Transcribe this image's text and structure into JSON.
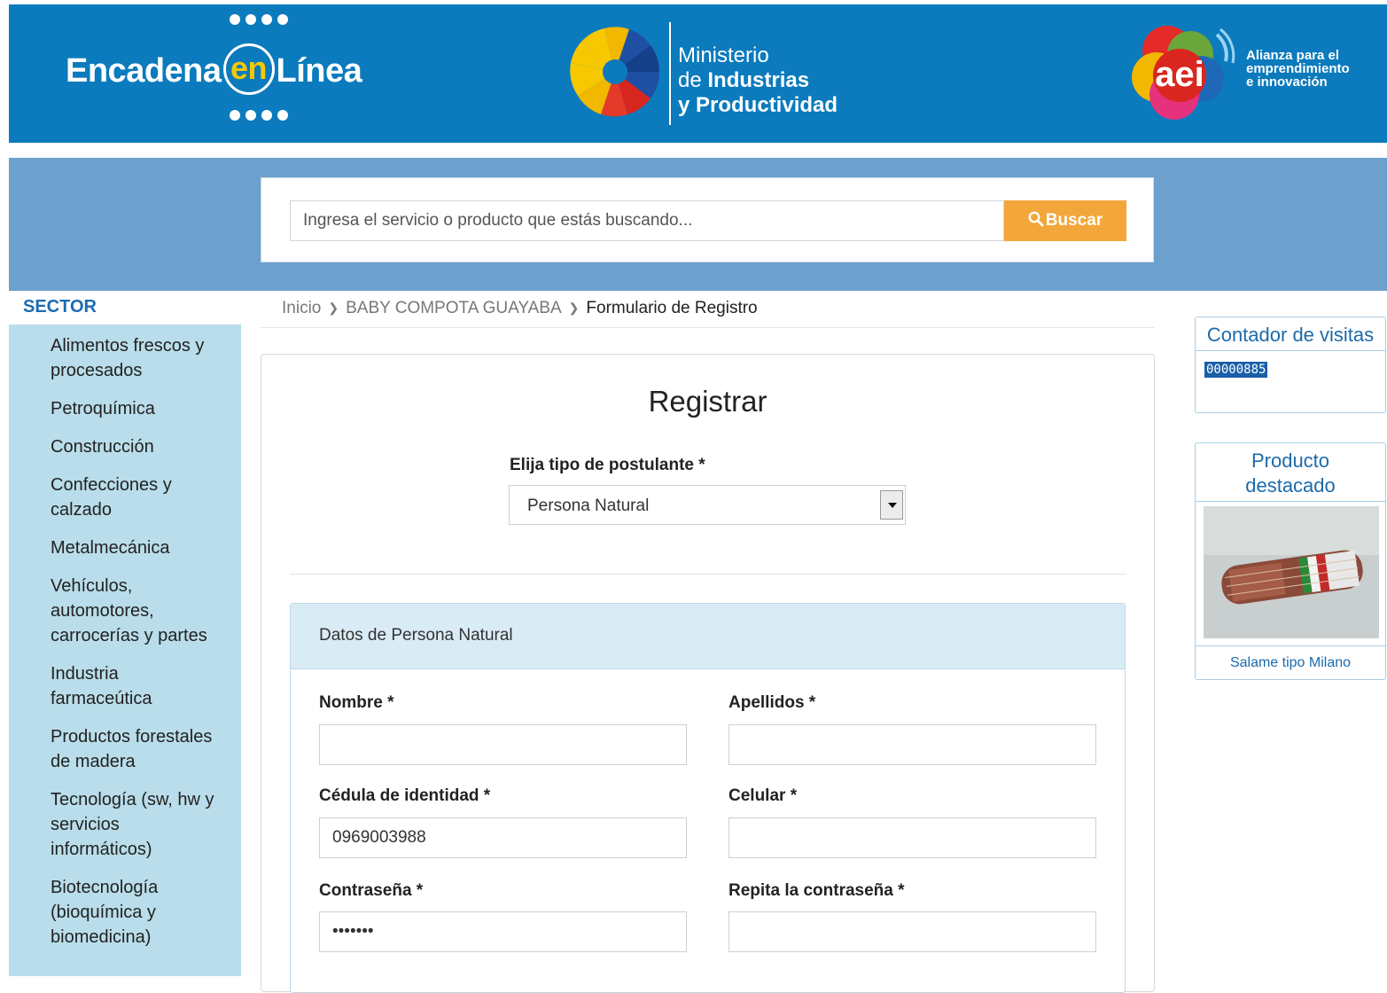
{
  "header": {
    "brand_part1": "Encadena",
    "brand_part2": "en",
    "brand_part3": "Línea",
    "ministry_line1": "Ministerio",
    "ministry_line2_pre": "de ",
    "ministry_line2_bold": "Industrias",
    "ministry_line3": "y Productividad",
    "aei_logo_text": "aei",
    "aei_line1": "Alianza para el",
    "aei_line2": "emprendimiento",
    "aei_line3": "e innovación"
  },
  "search": {
    "placeholder": "Ingresa el servicio o producto que estás buscando...",
    "button_label": "Buscar"
  },
  "sidebar": {
    "title": "SECTOR",
    "items": [
      {
        "label": "Alimentos frescos y procesados"
      },
      {
        "label": "Petroquímica"
      },
      {
        "label": "Construcción"
      },
      {
        "label": "Confecciones y calzado"
      },
      {
        "label": "Metalmecánica"
      },
      {
        "label": "Vehículos, automotores, carrocerías y partes"
      },
      {
        "label": "Industria farmaceútica"
      },
      {
        "label": "Productos forestales de madera"
      },
      {
        "label": "Tecnología (sw, hw y servicios informáticos)"
      },
      {
        "label": "Biotecnología (bioquímica y biomedicina)"
      }
    ]
  },
  "breadcrumb": {
    "items": [
      "Inicio",
      "BABY COMPOTA GUAYABA",
      "Formulario de Registro"
    ]
  },
  "form": {
    "title": "Registrar",
    "type_label": "Elija tipo de postulante *",
    "type_value": "Persona Natural",
    "section_title": "Datos de Persona Natural",
    "fields": {
      "nombre": {
        "label": "Nombre *",
        "value": ""
      },
      "apellidos": {
        "label": "Apellidos *",
        "value": ""
      },
      "cedula": {
        "label": "Cédula de identidad *",
        "value": "0969003988"
      },
      "celular": {
        "label": "Celular *",
        "value": ""
      },
      "password": {
        "label": "Contraseña *",
        "value": "1234567"
      },
      "password_repeat": {
        "label": "Repita la contraseña *",
        "value": ""
      }
    }
  },
  "widgets": {
    "counter_title": "Contador de visitas",
    "counter_value": "00000885",
    "product_title": "Producto destacado",
    "product_name": "Salame tipo Milano"
  },
  "colors": {
    "header_bg": "#0b7bbd",
    "search_band_bg": "#6ca0cd",
    "search_button": "#f3a73b",
    "sidebar_bg": "#b9ddea",
    "accent_text": "#1c6aab"
  }
}
